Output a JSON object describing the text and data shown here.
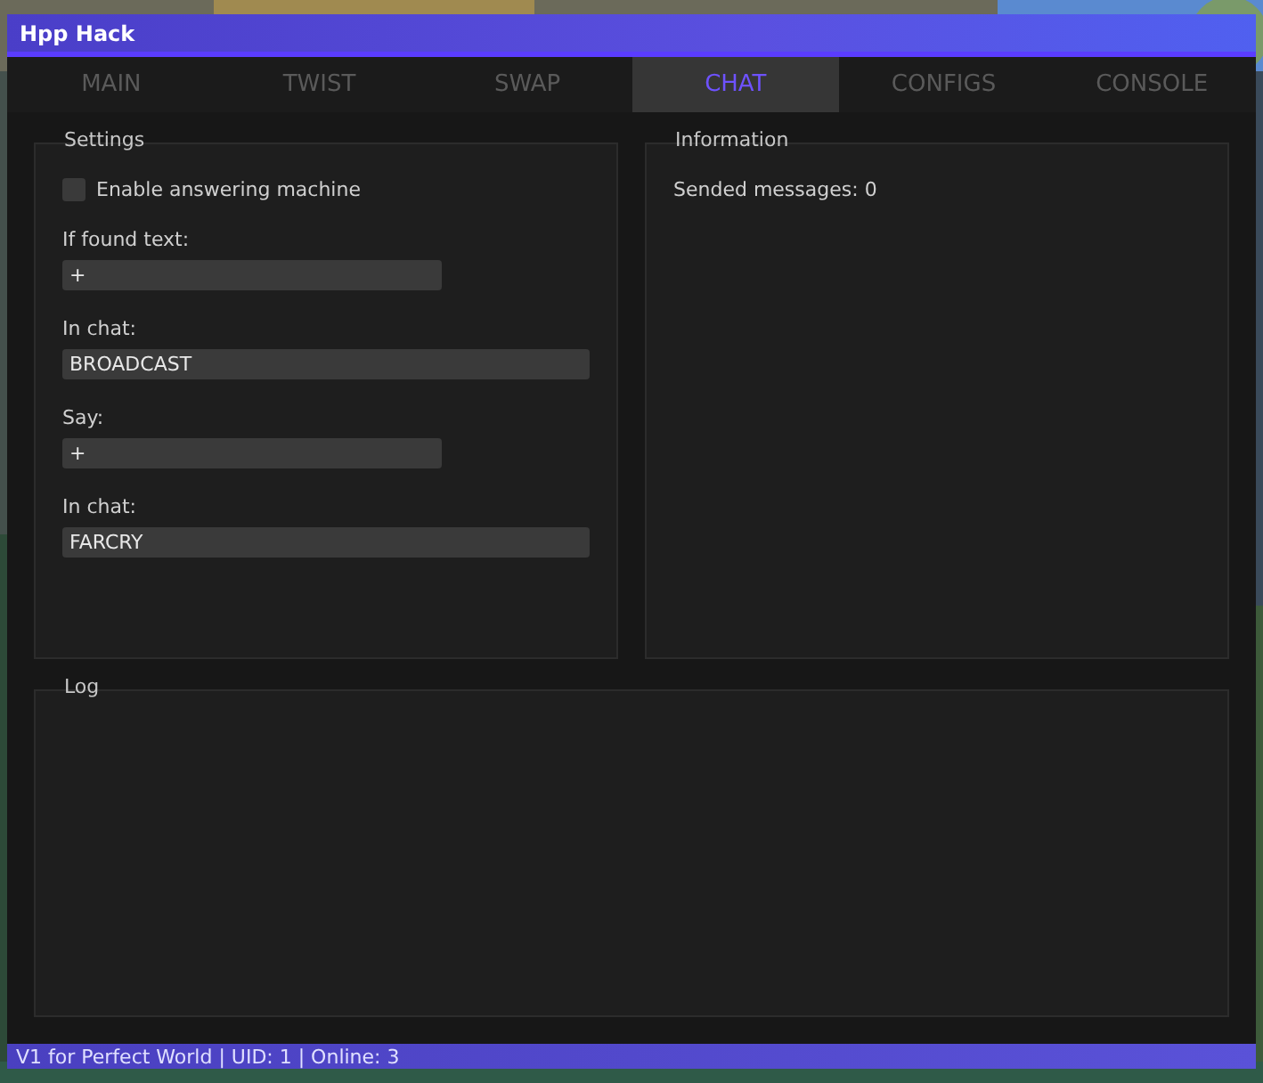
{
  "window": {
    "title": "Hpp Hack"
  },
  "tabs": [
    {
      "label": "MAIN",
      "selected": false
    },
    {
      "label": "TWIST",
      "selected": false
    },
    {
      "label": "SWAP",
      "selected": false
    },
    {
      "label": "CHAT",
      "selected": true
    },
    {
      "label": "CONFIGS",
      "selected": false
    },
    {
      "label": "CONSOLE",
      "selected": false
    }
  ],
  "settings": {
    "title": "Settings",
    "answering_machine": {
      "label": "Enable answering machine",
      "checked": false
    },
    "fields": [
      {
        "kind": "text",
        "label": "If found text:",
        "value": "+"
      },
      {
        "kind": "chat",
        "label": "In chat:",
        "value": "BROADCAST"
      },
      {
        "kind": "text",
        "label": "Say:",
        "value": "+"
      },
      {
        "kind": "chat",
        "label": "In chat:",
        "value": "FARCRY"
      }
    ]
  },
  "information": {
    "title": "Information",
    "lines": [
      "Sended messages: 0"
    ]
  },
  "log": {
    "title": "Log"
  },
  "status_bar": "V1 for Perfect World | UID: 1 | Online: 3"
}
